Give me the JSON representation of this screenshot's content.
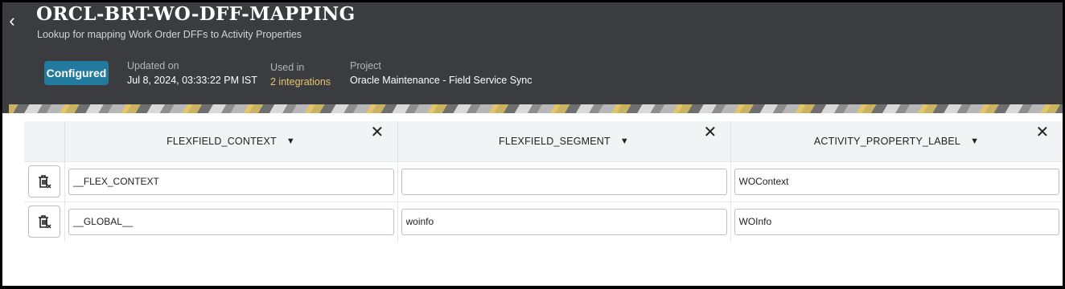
{
  "header": {
    "back_icon": "chevron-left-icon",
    "title": "ORCL-BRT-WO-DFF-MAPPING",
    "subtitle": "Lookup for mapping Work Order DFFs to Activity Properties",
    "status_badge": "Configured",
    "updated_label": "Updated on",
    "updated_value": "Jul 8, 2024, 03:33:22 PM IST",
    "used_in_label": "Used in",
    "used_in_value": "2 integrations",
    "project_label": "Project",
    "project_value": "Oracle Maintenance - Field Service Sync"
  },
  "colors": {
    "header_bg": "#3a3c3f",
    "badge_bg": "#227a9e",
    "link": "#e8c46a"
  },
  "table": {
    "columns": [
      {
        "label": "FLEXFIELD_CONTEXT",
        "sort_icon": "caret-down-icon",
        "close_icon": "close-icon"
      },
      {
        "label": "FLEXFIELD_SEGMENT",
        "sort_icon": "caret-down-icon",
        "close_icon": "close-icon"
      },
      {
        "label": "ACTIVITY_PROPERTY_LABEL",
        "sort_icon": "caret-down-icon",
        "close_icon": "close-icon"
      }
    ],
    "rows": [
      {
        "delete_icon": "trash-icon",
        "cells": [
          "__FLEX_CONTEXT",
          "",
          "WOContext"
        ]
      },
      {
        "delete_icon": "trash-icon",
        "cells": [
          "__GLOBAL__",
          "woinfo",
          "WOInfo"
        ]
      }
    ]
  }
}
